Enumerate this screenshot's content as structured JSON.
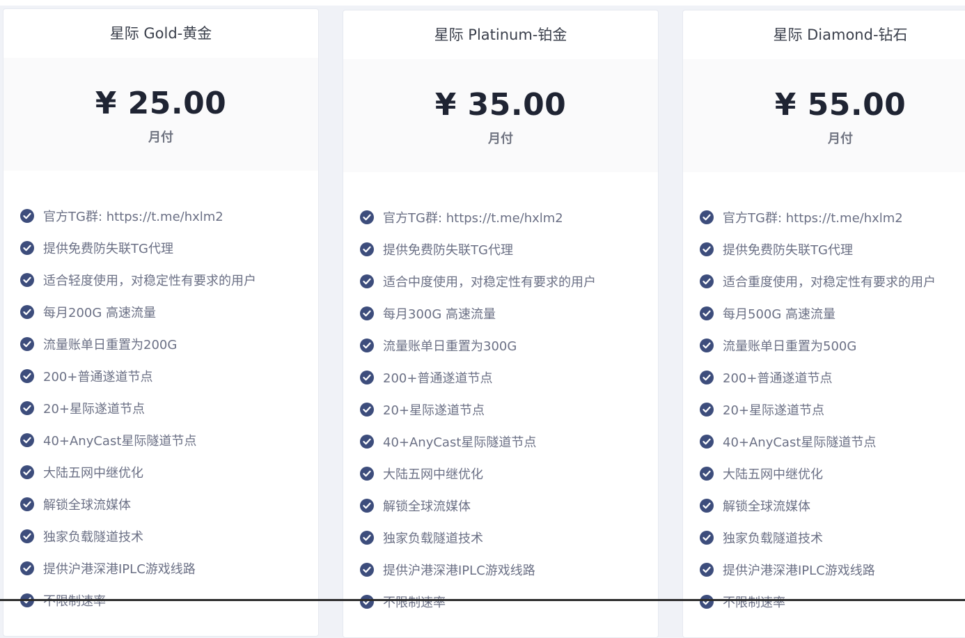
{
  "plans": [
    {
      "title": "星际 Gold-黄金",
      "price": "¥ 25.00",
      "period": "月付",
      "features": [
        "官方TG群: https://t.me/hxlm2",
        "提供免费防失联TG代理",
        "适合轻度使用，对稳定性有要求的用户",
        "每月200G 高速流量",
        "流量账单日重置为200G",
        "200+普通遂道节点",
        "20+星际遂道节点",
        "40+AnyCast星际隧道节点",
        "大陆五网中继优化",
        "解锁全球流媒体",
        "独家负载隧道技术",
        "提供沪港深港IPLC游戏线路",
        "不限制速率"
      ]
    },
    {
      "title": "星际 Platinum-铂金",
      "price": "¥ 35.00",
      "period": "月付",
      "features": [
        "官方TG群: https://t.me/hxlm2",
        "提供免费防失联TG代理",
        "适合中度使用，对稳定性有要求的用户",
        "每月300G 高速流量",
        "流量账单日重置为300G",
        "200+普通遂道节点",
        "20+星际遂道节点",
        "40+AnyCast星际隧道节点",
        "大陆五网中继优化",
        "解锁全球流媒体",
        "独家负载隧道技术",
        "提供沪港深港IPLC游戏线路",
        "不限制速率"
      ]
    },
    {
      "title": "星际 Diamond-钻石",
      "price": "¥ 55.00",
      "period": "月付",
      "features": [
        "官方TG群: https://t.me/hxlm2",
        "提供免费防失联TG代理",
        "适合重度使用，对稳定性有要求的用户",
        "每月500G 高速流量",
        "流量账单日重置为500G",
        "200+普通遂道节点",
        "20+星际遂道节点",
        "40+AnyCast星际隧道节点",
        "大陆五网中继优化",
        "解锁全球流媒体",
        "独家负载隧道技术",
        "提供沪港深港IPLC游戏线路",
        "不限制速率"
      ]
    }
  ],
  "icons": {
    "feature": "check-circle-icon"
  },
  "colors": {
    "check": "#3d4d7c",
    "price": "#1f2433",
    "feature_text": "#6b7085"
  }
}
